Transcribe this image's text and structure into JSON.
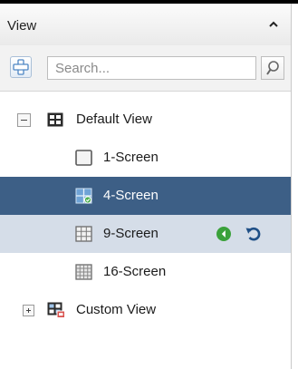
{
  "panel": {
    "title": "View",
    "collapse_icon": "chevron-up-icon"
  },
  "toolbar": {
    "add_icon": "add-icon",
    "search_placeholder": "Search...",
    "search_icon": "search-icon"
  },
  "tree": {
    "default_view": {
      "label": "Default View",
      "expanded": true,
      "icon": "view-group-icon",
      "children": [
        {
          "label": "1-Screen",
          "icon": "single-screen-icon",
          "state": "normal"
        },
        {
          "label": "4-Screen",
          "icon": "quad-screen-icon",
          "state": "selected"
        },
        {
          "label": "9-Screen",
          "icon": "nine-screen-icon",
          "state": "hover",
          "actions": [
            "play-icon",
            "refresh-icon"
          ]
        },
        {
          "label": "16-Screen",
          "icon": "sixteen-screen-icon",
          "state": "normal"
        }
      ]
    },
    "custom_view": {
      "label": "Custom View",
      "expanded": false,
      "icon": "custom-view-icon"
    }
  },
  "colors": {
    "selected_row": "#3d5f86",
    "hover_row": "#d5dde8",
    "play_icon": "#3aa13a",
    "refresh_icon": "#1f4f86"
  }
}
